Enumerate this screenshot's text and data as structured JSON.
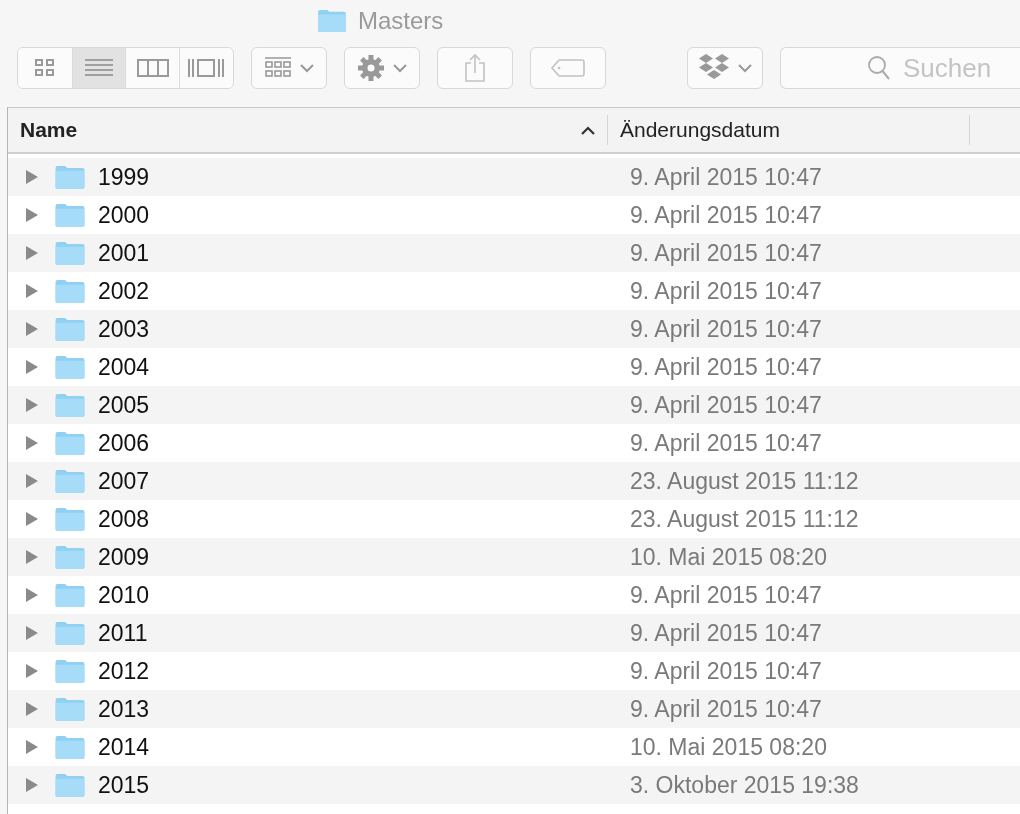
{
  "window": {
    "title": "Masters"
  },
  "toolbar": {
    "view_modes": [
      {
        "kind": "icons",
        "selected": false
      },
      {
        "kind": "list",
        "selected": true
      },
      {
        "kind": "columns",
        "selected": false
      },
      {
        "kind": "coverflow",
        "selected": false
      }
    ],
    "search": {
      "placeholder": "Suchen"
    }
  },
  "table": {
    "columns": [
      {
        "label": "Name",
        "sorted": true
      },
      {
        "label": "Änderungsdatum",
        "sorted": false
      }
    ],
    "rows": [
      {
        "name": "1999",
        "modified": "9. April 2015 10:47",
        "expanded": false
      },
      {
        "name": "2000",
        "modified": "9. April 2015 10:47",
        "expanded": false
      },
      {
        "name": "2001",
        "modified": "9. April 2015 10:47",
        "expanded": false
      },
      {
        "name": "2002",
        "modified": "9. April 2015 10:47",
        "expanded": false
      },
      {
        "name": "2003",
        "modified": "9. April 2015 10:47",
        "expanded": false
      },
      {
        "name": "2004",
        "modified": "9. April 2015 10:47",
        "expanded": false
      },
      {
        "name": "2005",
        "modified": "9. April 2015 10:47",
        "expanded": false
      },
      {
        "name": "2006",
        "modified": "9. April 2015 10:47",
        "expanded": false
      },
      {
        "name": "2007",
        "modified": "23. August 2015 11:12",
        "expanded": false
      },
      {
        "name": "2008",
        "modified": "23. August 2015 11:12",
        "expanded": false
      },
      {
        "name": "2009",
        "modified": "10. Mai 2015 08:20",
        "expanded": false
      },
      {
        "name": "2010",
        "modified": "9. April 2015 10:47",
        "expanded": false
      },
      {
        "name": "2011",
        "modified": "9. April 2015 10:47",
        "expanded": false
      },
      {
        "name": "2012",
        "modified": "9. April 2015 10:47",
        "expanded": false
      },
      {
        "name": "2013",
        "modified": "9. April 2015 10:47",
        "expanded": false
      },
      {
        "name": "2014",
        "modified": "10. Mai 2015 08:20",
        "expanded": false
      },
      {
        "name": "2015",
        "modified": "3. Oktober 2015 19:38",
        "expanded": false
      }
    ]
  }
}
